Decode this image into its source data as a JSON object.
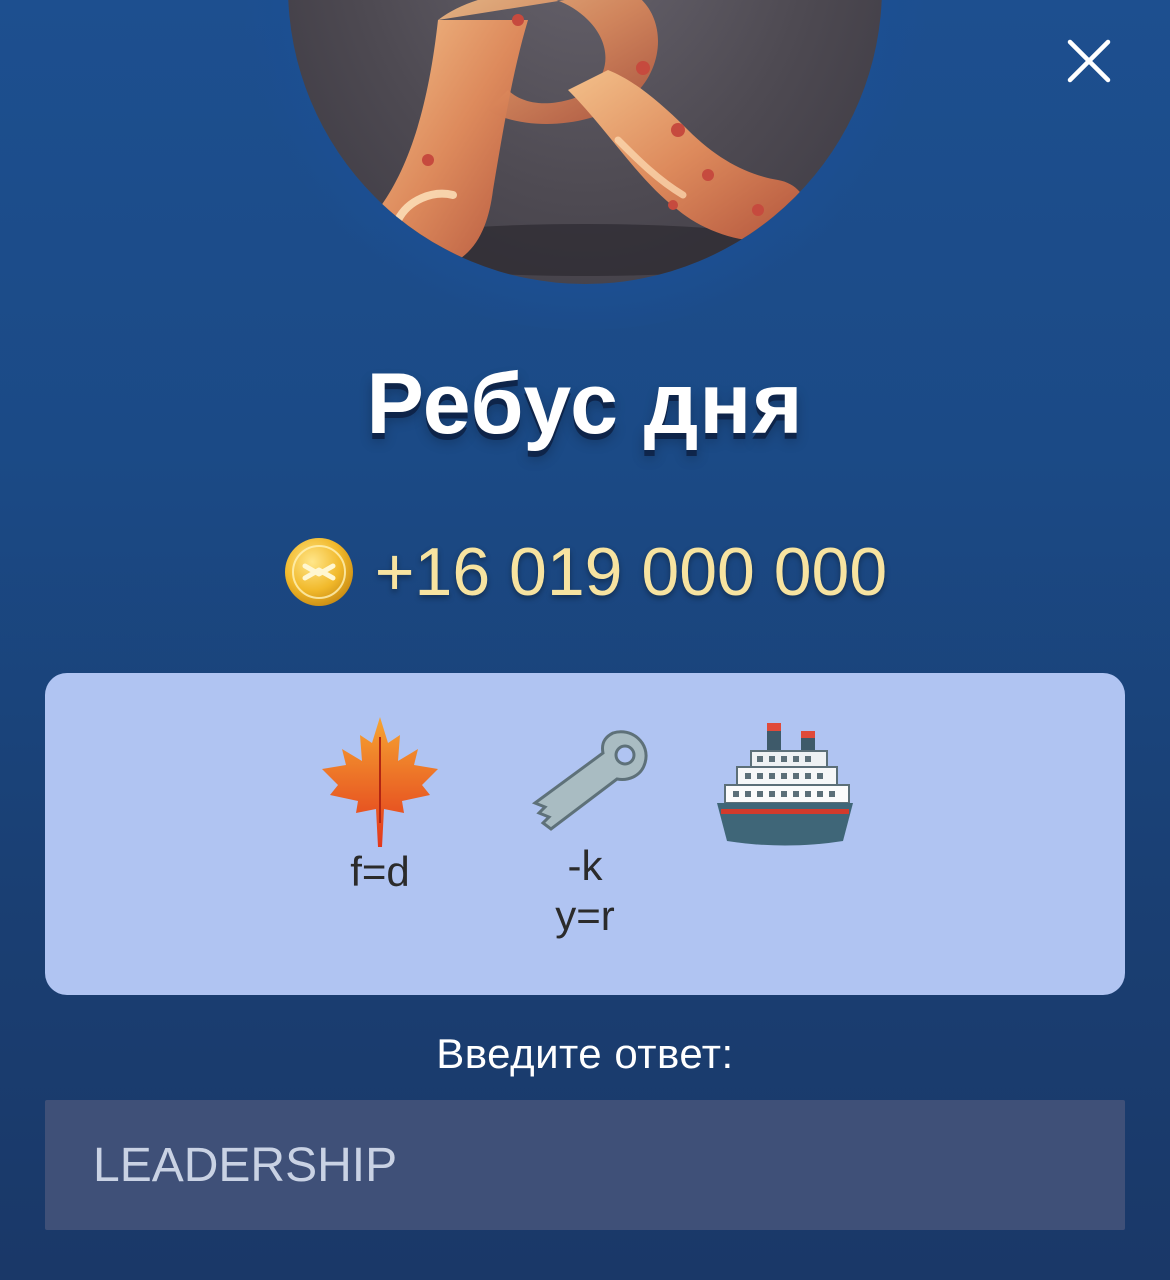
{
  "header": {
    "title": "Ребус дня",
    "close_icon": "close-icon"
  },
  "hero": {
    "icon": "letter-r-balloon-icon"
  },
  "reward": {
    "coin_icon": "coin-icon",
    "amount": "+16 019 000 000"
  },
  "rebus": {
    "items": [
      {
        "icon": "maple-leaf-icon",
        "hints": [
          "f=d"
        ]
      },
      {
        "icon": "key-icon",
        "hints": [
          "-k",
          "y=r"
        ]
      },
      {
        "icon": "ship-icon",
        "hints": []
      }
    ]
  },
  "answer": {
    "label": "Введите ответ:",
    "value": "LEADERSHIP"
  },
  "colors": {
    "background": "#1c4a86",
    "card": "#b0c4f2",
    "reward_text": "#f7e3a0",
    "input_bg": "#3f5078"
  }
}
